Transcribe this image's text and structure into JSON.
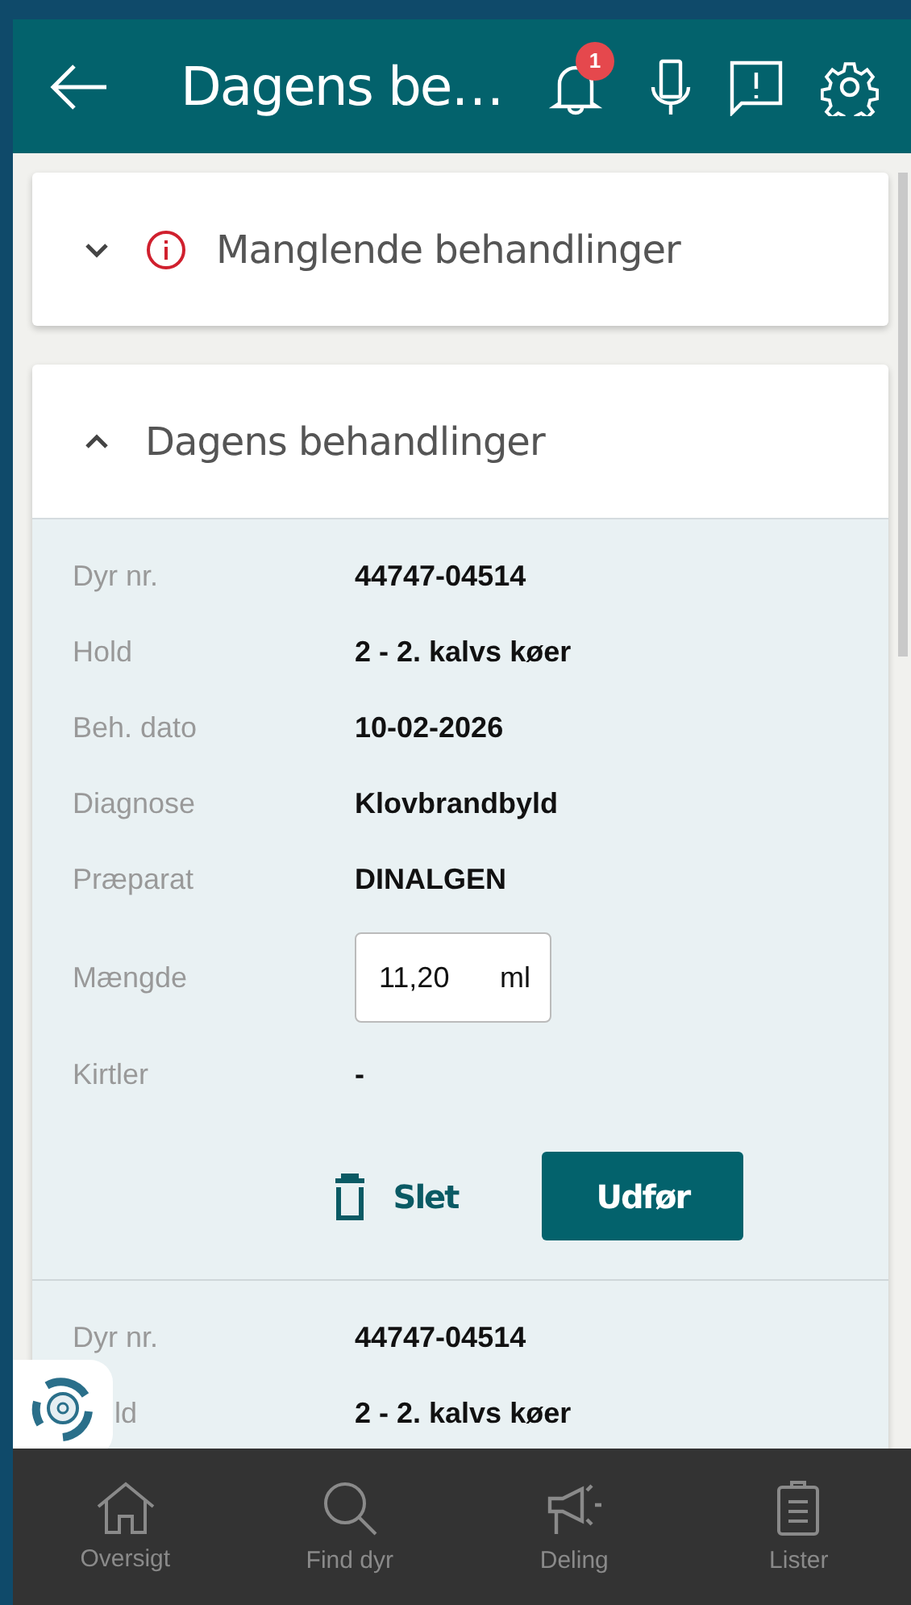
{
  "header": {
    "title": "Dagens be…",
    "notification_badge": "1"
  },
  "sections": [
    {
      "title": "Manglende behandlinger",
      "expanded": false,
      "warning": true
    },
    {
      "title": "Dagens behandlinger",
      "expanded": true,
      "warning": false,
      "records": [
        {
          "fields": [
            {
              "kind": "text",
              "label": "Dyr nr.",
              "value": "44747-04514"
            },
            {
              "kind": "text",
              "label": "Hold",
              "value": "2 - 2. kalvs køer"
            },
            {
              "kind": "text",
              "label": "Beh. dato",
              "value": "10-02-2026"
            },
            {
              "kind": "text",
              "label": "Diagnose",
              "value": "Klovbrandbyld"
            },
            {
              "kind": "text",
              "label": "Præparat",
              "value": "DINALGEN"
            },
            {
              "kind": "input",
              "label": "Mængde",
              "value": "11,20",
              "unit": "ml"
            },
            {
              "kind": "text",
              "label": "Kirtler",
              "value": "-"
            }
          ],
          "delete_label": "Slet",
          "submit_label": "Udfør"
        },
        {
          "fields": [
            {
              "kind": "text",
              "label": "Dyr nr.",
              "value": "44747-04514"
            },
            {
              "kind": "text",
              "label": "ld",
              "value": "2 - 2. kalvs køer"
            }
          ]
        }
      ]
    }
  ],
  "nav": [
    {
      "label": "Oversigt"
    },
    {
      "label": "Find dyr"
    },
    {
      "label": "Deling"
    },
    {
      "label": "Lister"
    }
  ]
}
